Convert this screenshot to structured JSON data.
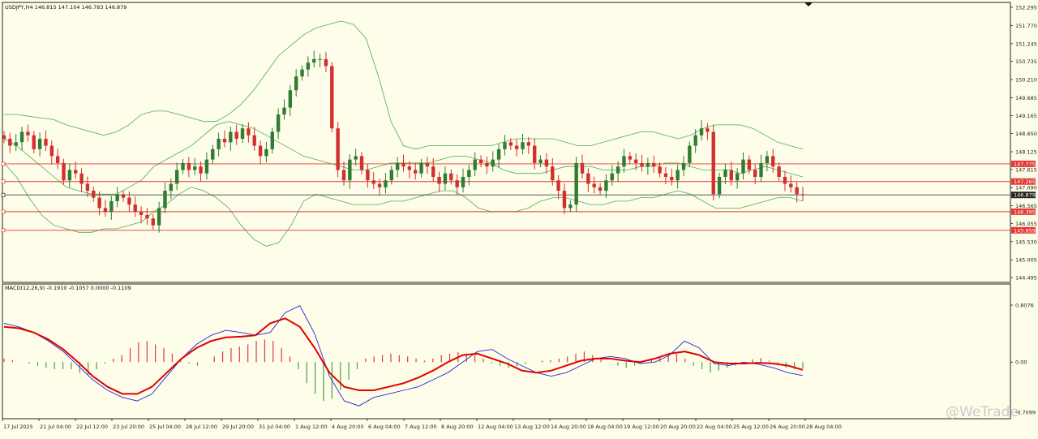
{
  "header": {
    "symbol_info": "USDJPY,H4  146.815 147.104 146.783 146.879",
    "macd_info": "MACD(12,26,9) -0.1910 -0.1057 0.0000 -0.1109"
  },
  "watermark": {
    "text": "@WeTrade"
  },
  "colors": {
    "background": "#fdfde9",
    "bull": "#2e7d32",
    "bear": "#d32f2f",
    "bollinger": "#4caf50",
    "hline": "#e53935",
    "current_price_line": "#444444",
    "macd_line": "#2727d8",
    "signal_line": "#e00000",
    "hist_pos": "#e53935",
    "hist_neg": "#43a047"
  },
  "price_axis": {
    "ticks": [
      "152.295",
      "151.770",
      "151.245",
      "150.735",
      "150.210",
      "149.685",
      "149.165",
      "148.650",
      "148.125",
      "147.615",
      "147.090",
      "146.565",
      "146.055",
      "145.530",
      "145.005",
      "144.495"
    ]
  },
  "price_tags": [
    {
      "label": "147.775",
      "value": 147.775,
      "kind": "level"
    },
    {
      "label": "147.265",
      "value": 147.265,
      "kind": "level"
    },
    {
      "label": "146.879",
      "value": 146.879,
      "kind": "current"
    },
    {
      "label": "146.395",
      "value": 146.395,
      "kind": "level"
    },
    {
      "label": "145.859",
      "value": 145.859,
      "kind": "level"
    }
  ],
  "macd_axis": {
    "ticks": [
      "0.8076",
      "0.00",
      "-0.7099"
    ]
  },
  "time_axis": {
    "labels": [
      "17 Jul 2025",
      "21 Jul 04:00",
      "22 Jul 12:00",
      "23 Jul 20:00",
      "25 Jul 04:00",
      "28 Jul 12:00",
      "29 Jul 20:00",
      "31 Jul 04:00",
      "1 Aug 12:00",
      "4 Aug 20:00",
      "6 Aug 04:00",
      "7 Aug 12:00",
      "8 Aug 20:00",
      "12 Aug 04:00",
      "13 Aug 12:00",
      "14 Aug 20:00",
      "18 Aug 04:00",
      "19 Aug 12:00",
      "20 Aug 20:00",
      "22 Aug 04:00",
      "25 Aug 12:00",
      "26 Aug 20:00",
      "28 Aug 04:00"
    ]
  },
  "chart_data": [
    {
      "type": "candlestick",
      "title": "USDJPY,H4",
      "ylim": [
        144.495,
        152.295
      ],
      "close_series": [
        148.5,
        148.3,
        148.4,
        148.7,
        148.6,
        148.2,
        148.5,
        148.3,
        148.0,
        147.8,
        147.3,
        147.6,
        147.5,
        147.2,
        147.0,
        146.8,
        146.5,
        146.4,
        146.7,
        146.9,
        146.8,
        146.6,
        146.4,
        146.3,
        146.2,
        146.0,
        146.5,
        147.0,
        147.2,
        147.6,
        147.8,
        147.6,
        147.7,
        147.5,
        147.9,
        148.2,
        148.5,
        148.4,
        148.7,
        148.5,
        148.8,
        148.6,
        148.3,
        148.0,
        148.2,
        148.7,
        149.2,
        149.4,
        149.9,
        150.3,
        150.5,
        150.7,
        150.8,
        150.8,
        150.6,
        148.8,
        147.6,
        147.3,
        147.9,
        148.0,
        147.6,
        147.3,
        147.2,
        147.1,
        147.3,
        147.6,
        147.8,
        147.7,
        147.6,
        147.5,
        147.8,
        147.7,
        147.4,
        147.2,
        147.5,
        147.3,
        147.1,
        147.4,
        147.6,
        147.9,
        147.8,
        147.7,
        147.9,
        148.2,
        148.4,
        148.3,
        148.2,
        148.4,
        148.3,
        147.8,
        147.9,
        147.7,
        147.3,
        147.0,
        146.5,
        146.6,
        147.8,
        147.5,
        147.2,
        147.1,
        147.0,
        147.3,
        147.5,
        147.7,
        148.0,
        147.9,
        147.8,
        147.7,
        147.8,
        147.7,
        147.5,
        147.4,
        147.3,
        147.6,
        147.8,
        148.3,
        148.6,
        148.8,
        148.7,
        146.9,
        147.4,
        147.6,
        147.3,
        147.5,
        147.9,
        147.6,
        147.4,
        147.8,
        148.0,
        147.7,
        147.4,
        147.2,
        147.1,
        146.9,
        146.88
      ],
      "bollinger_upper": [
        149.2,
        149.2,
        149.15,
        149.1,
        149.05,
        148.9,
        148.8,
        148.7,
        148.6,
        148.7,
        148.9,
        149.2,
        149.3,
        149.3,
        149.2,
        149.1,
        149.0,
        149.0,
        149.2,
        149.5,
        149.9,
        150.4,
        150.9,
        151.2,
        151.5,
        151.7,
        151.8,
        151.9,
        151.8,
        151.4,
        150.3,
        149.0,
        148.3,
        148.2,
        148.3,
        148.3,
        148.3,
        148.3,
        148.3,
        148.3,
        148.4,
        148.5,
        148.5,
        148.5,
        148.5,
        148.4,
        148.3,
        148.3,
        148.4,
        148.5,
        148.6,
        148.7,
        148.7,
        148.6,
        148.5,
        148.6,
        148.8,
        148.9,
        148.9,
        148.9,
        148.8,
        148.6,
        148.4,
        148.3,
        148.2
      ],
      "bollinger_middle": [
        148.5,
        148.3,
        148.0,
        147.7,
        147.4,
        147.1,
        147.0,
        146.9,
        146.9,
        146.9,
        147.1,
        147.3,
        147.7,
        147.9,
        148.1,
        148.3,
        148.6,
        148.9,
        149.0,
        148.9,
        148.8,
        148.6,
        148.4,
        148.2,
        148.0,
        147.9,
        147.8,
        147.7,
        147.6,
        147.6,
        147.7,
        147.8,
        147.8,
        147.8,
        147.8,
        147.9,
        148.0,
        148.0,
        147.9,
        147.8,
        147.6,
        147.5,
        147.5,
        147.5,
        147.6,
        147.7,
        147.7,
        147.7,
        147.6,
        147.6,
        147.6,
        147.7,
        147.7,
        147.8,
        147.8,
        147.7,
        147.6,
        147.6,
        147.6,
        147.5,
        147.6,
        147.7,
        147.6,
        147.5,
        147.4
      ],
      "bollinger_lower": [
        147.8,
        147.4,
        146.8,
        146.3,
        146.0,
        145.9,
        145.8,
        145.8,
        145.9,
        145.9,
        146.0,
        146.1,
        146.4,
        146.6,
        146.9,
        147.1,
        147.0,
        146.8,
        146.5,
        146.0,
        145.6,
        145.4,
        145.5,
        146.0,
        146.7,
        146.9,
        146.8,
        146.7,
        146.6,
        146.6,
        146.6,
        146.7,
        146.7,
        146.8,
        146.9,
        147.0,
        147.0,
        146.8,
        146.5,
        146.4,
        146.4,
        146.4,
        146.5,
        146.7,
        146.8,
        146.8,
        146.7,
        146.6,
        146.6,
        146.7,
        146.7,
        146.8,
        146.8,
        146.9,
        147.0,
        146.9,
        146.7,
        146.5,
        146.5,
        146.5,
        146.6,
        146.7,
        146.8,
        146.8,
        146.7
      ],
      "hlines": [
        147.775,
        147.265,
        146.879,
        146.395,
        145.859
      ]
    },
    {
      "type": "line",
      "title": "MACD(12,26,9)",
      "ylim": [
        -0.7099,
        0.8076
      ],
      "series": [
        {
          "name": "MACD",
          "values": [
            0.55,
            0.5,
            0.42,
            0.3,
            0.15,
            -0.05,
            -0.25,
            -0.4,
            -0.5,
            -0.55,
            -0.45,
            -0.2,
            0.05,
            0.25,
            0.38,
            0.45,
            0.42,
            0.38,
            0.42,
            0.7,
            0.8,
            0.4,
            -0.2,
            -0.55,
            -0.62,
            -0.5,
            -0.45,
            -0.4,
            -0.35,
            -0.25,
            -0.15,
            0.0,
            0.15,
            0.18,
            0.05,
            -0.05,
            -0.15,
            -0.2,
            -0.15,
            -0.05,
            0.05,
            0.08,
            0.05,
            -0.02,
            0.0,
            0.1,
            0.3,
            0.2,
            -0.02,
            -0.05,
            0.0,
            -0.03,
            -0.08,
            -0.15,
            -0.19
          ]
        },
        {
          "name": "Signal",
          "values": [
            0.5,
            0.48,
            0.42,
            0.32,
            0.18,
            0.0,
            -0.2,
            -0.35,
            -0.45,
            -0.45,
            -0.35,
            -0.15,
            0.05,
            0.2,
            0.3,
            0.35,
            0.36,
            0.38,
            0.55,
            0.62,
            0.5,
            0.2,
            -0.15,
            -0.35,
            -0.4,
            -0.4,
            -0.35,
            -0.3,
            -0.22,
            -0.12,
            0.0,
            0.1,
            0.12,
            0.05,
            -0.02,
            -0.12,
            -0.15,
            -0.12,
            -0.05,
            0.02,
            0.05,
            0.05,
            0.02,
            0.0,
            0.05,
            0.12,
            0.15,
            0.1,
            0.0,
            -0.02,
            -0.02,
            -0.01,
            -0.02,
            -0.05,
            -0.11
          ]
        }
      ],
      "histogram": [
        0.05,
        0.03,
        0.0,
        -0.02,
        -0.05,
        -0.08,
        -0.1,
        -0.1,
        -0.1,
        -0.15,
        -0.18,
        -0.1,
        -0.02,
        0.05,
        0.1,
        0.2,
        0.28,
        0.3,
        0.25,
        0.2,
        0.12,
        0.05,
        -0.02,
        -0.05,
        0.0,
        0.08,
        0.15,
        0.2,
        0.22,
        0.25,
        0.3,
        0.32,
        0.3,
        0.2,
        0.08,
        -0.1,
        -0.3,
        -0.45,
        -0.55,
        -0.52,
        -0.4,
        -0.25,
        -0.1,
        0.05,
        0.08,
        0.1,
        0.12,
        0.1,
        0.08,
        0.05,
        0.02,
        0.05,
        0.1,
        0.12,
        0.14,
        0.12,
        0.1,
        0.05,
        -0.02,
        -0.05,
        -0.08,
        -0.06,
        -0.03,
        0.0,
        0.02,
        0.03,
        0.05,
        0.08,
        0.12,
        0.15,
        0.1,
        0.05,
        0.0,
        -0.05,
        -0.08,
        -0.05,
        0.0,
        0.04,
        0.08,
        0.12,
        0.12,
        0.05,
        -0.05,
        -0.1,
        -0.15,
        -0.12,
        -0.08,
        -0.05,
        0.0,
        0.04,
        0.06,
        0.02,
        -0.04,
        -0.08,
        -0.1,
        -0.09
      ]
    }
  ]
}
